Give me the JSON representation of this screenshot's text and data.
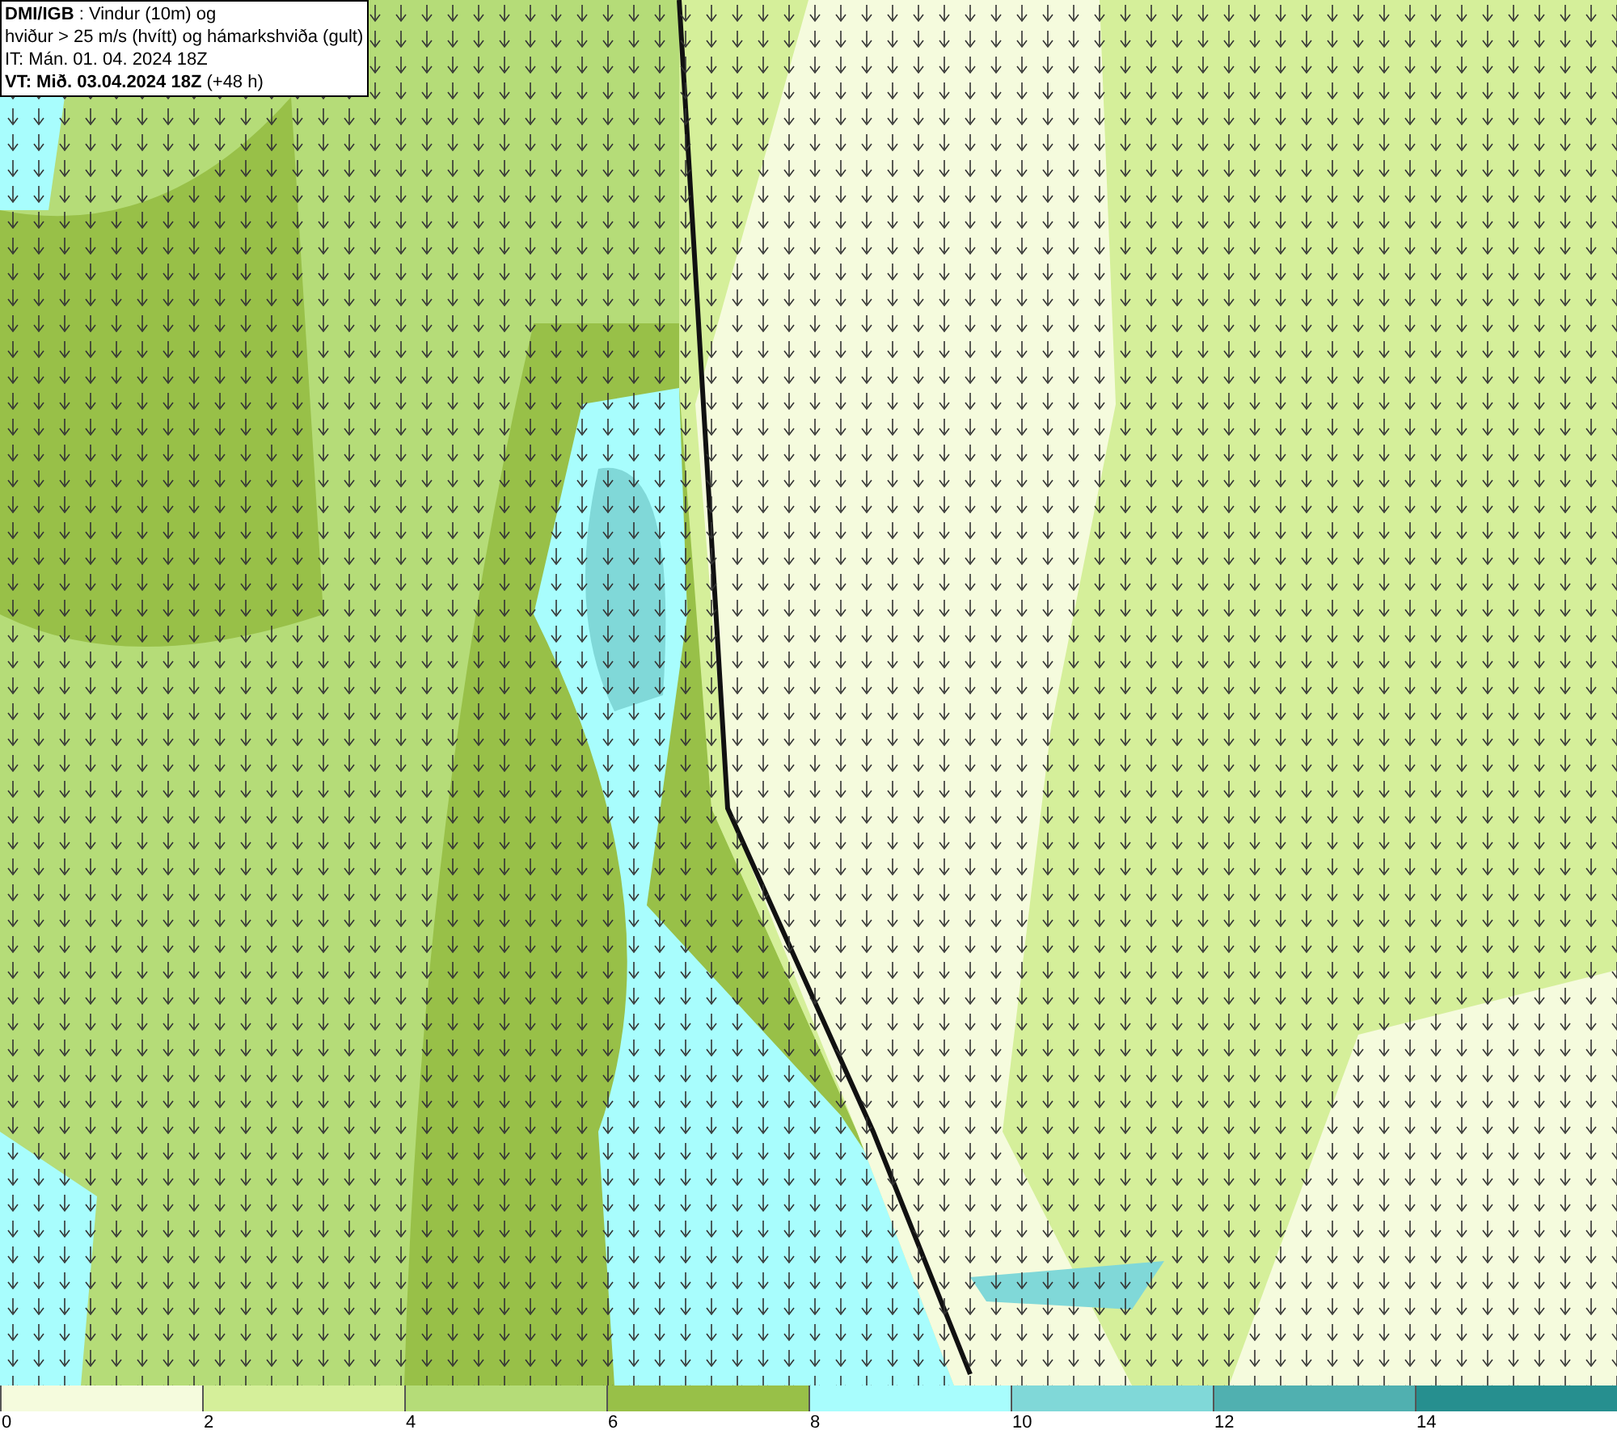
{
  "title_box": {
    "lines": [
      "**DMI/IGB** : Vindur (10m) og",
      "hviður > 25 m/s (hvítt) og hámarkshviða (gult)",
      "IT: Mán. 01. 04. 2024 18Z",
      "**VT: Mið. 03.04.2024 18Z** (+48 h)"
    ]
  },
  "legend": {
    "bins": [
      {
        "color": "#f5fbdd"
      },
      {
        "color": "#d5ef9a"
      },
      {
        "color": "#b5dc78"
      },
      {
        "color": "#98c048"
      },
      {
        "color": "#a8fdfd"
      },
      {
        "color": "#80d8d8"
      },
      {
        "color": "#50b0b0"
      },
      {
        "color": "#268f8f"
      }
    ],
    "ticks": [
      "0",
      "2",
      "4",
      "6",
      "8",
      "10",
      "12",
      "14"
    ]
  }
}
